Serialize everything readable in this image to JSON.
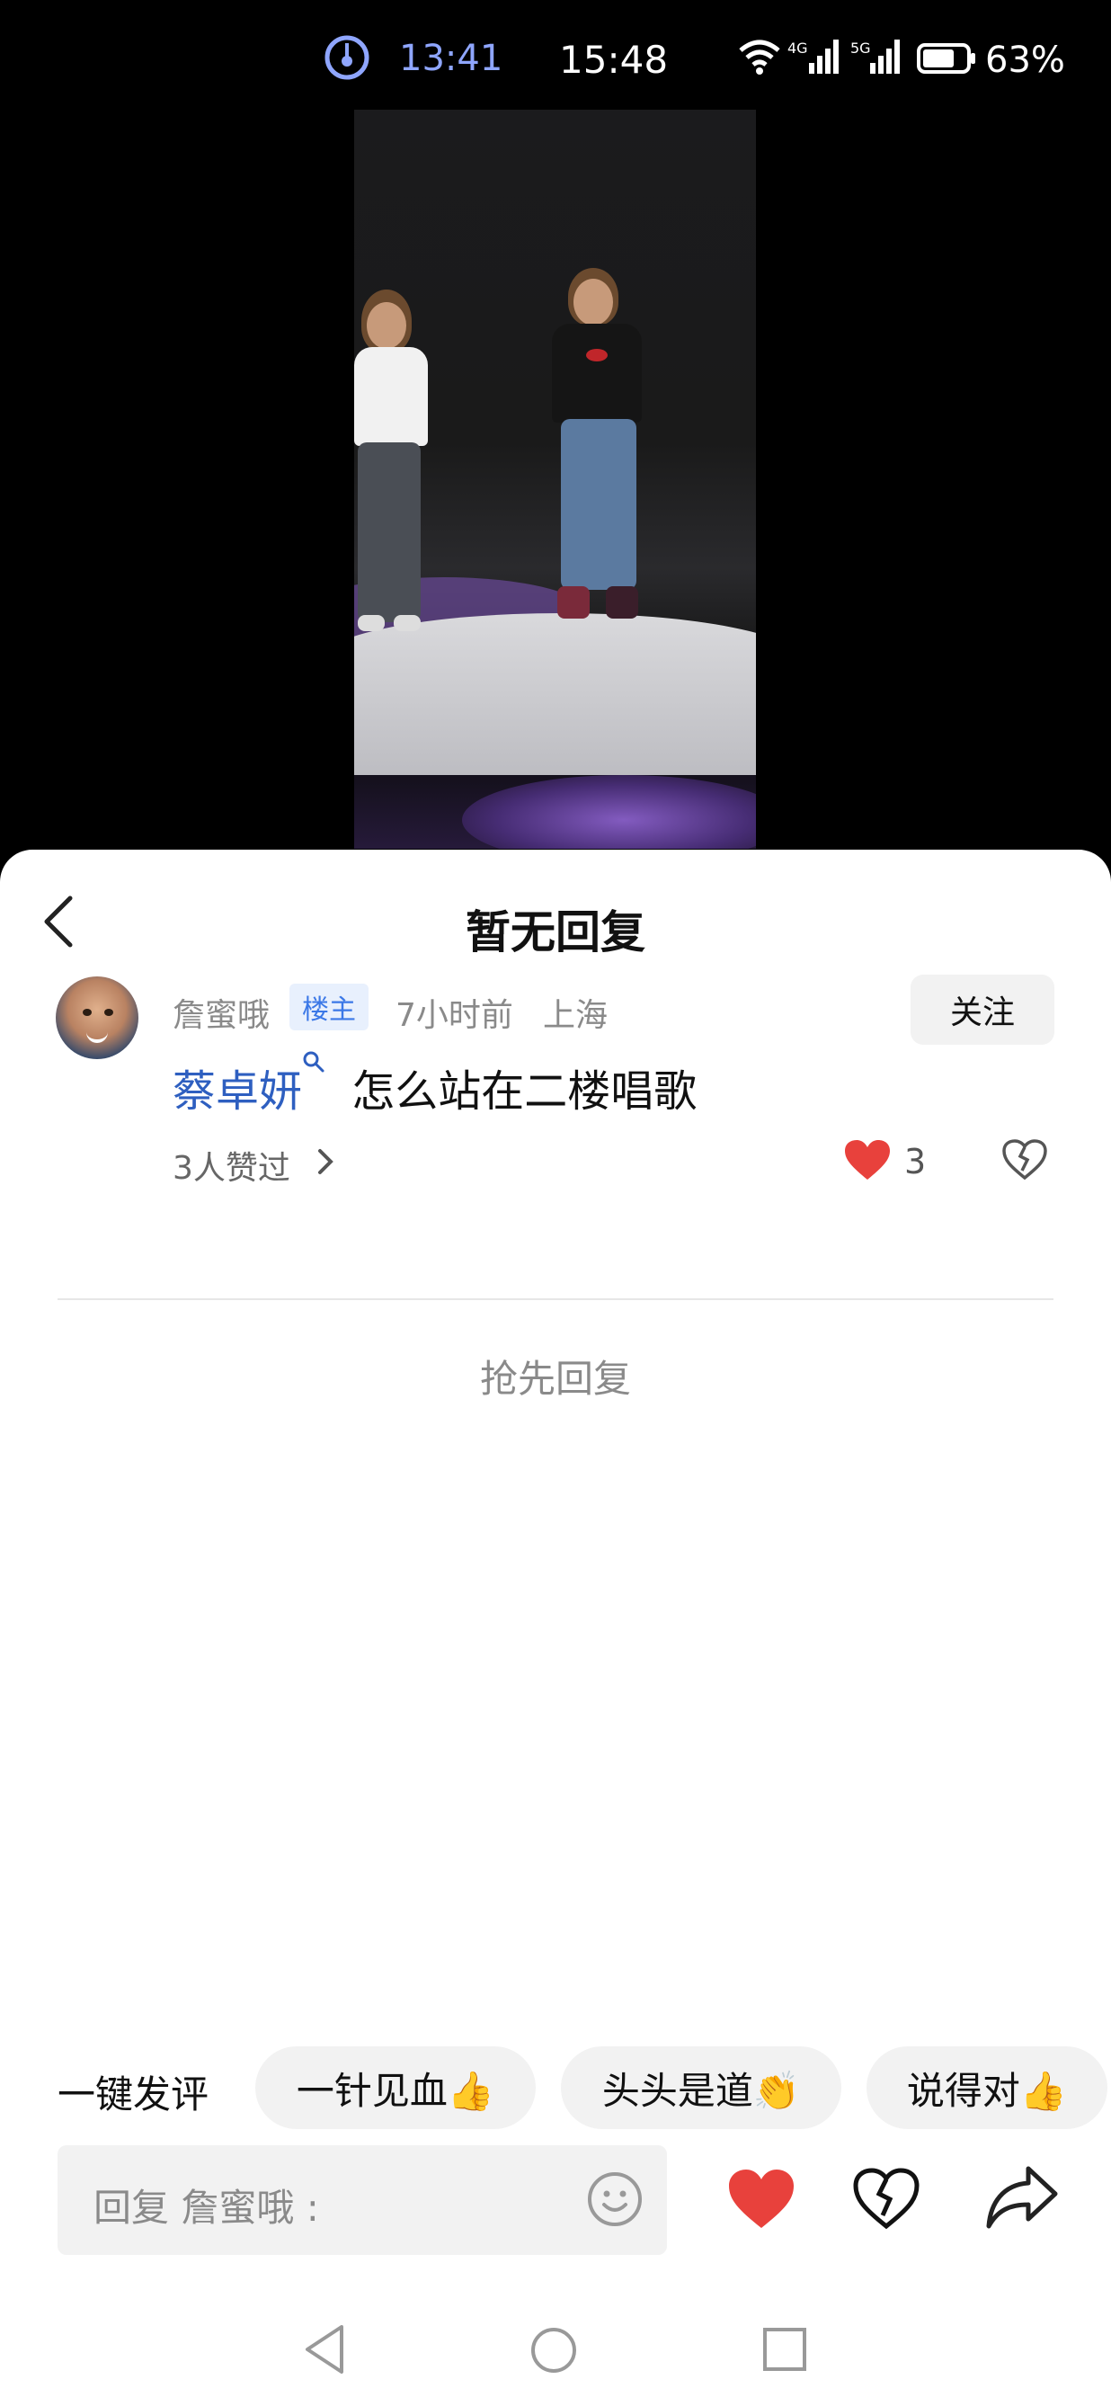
{
  "status_bar": {
    "timer_text": "13:41",
    "clock": "15:48",
    "network_1": "4G",
    "network_2": "5G",
    "battery": "63%"
  },
  "sheet": {
    "title": "暂无回复"
  },
  "comment": {
    "user": "詹蜜哦",
    "badge": "楼主",
    "time": "7小时前",
    "location": "上海",
    "follow_label": "关注",
    "mention": "蔡卓妍",
    "text": " 怎么站在二楼唱歌",
    "likers": "3人赞过",
    "like_count": "3"
  },
  "empty_state": "抢先回复",
  "quick_replies": {
    "label": "一键发评",
    "chips": [
      "一针见血👍",
      "头头是道👏",
      "说得对👍"
    ]
  },
  "input": {
    "placeholder": "回复 詹蜜哦 :"
  },
  "icons": {
    "timer": "timer-icon",
    "wifi": "wifi-icon",
    "back": "back-icon",
    "search": "search-icon",
    "heart": "heart-icon",
    "broken_heart": "broken-heart-icon",
    "emoji": "emoji-icon",
    "share": "share-icon"
  },
  "colors": {
    "accent_blue": "#2e5fc0",
    "heart_red": "#e8413c",
    "badge_bg": "#e8f0fd"
  }
}
